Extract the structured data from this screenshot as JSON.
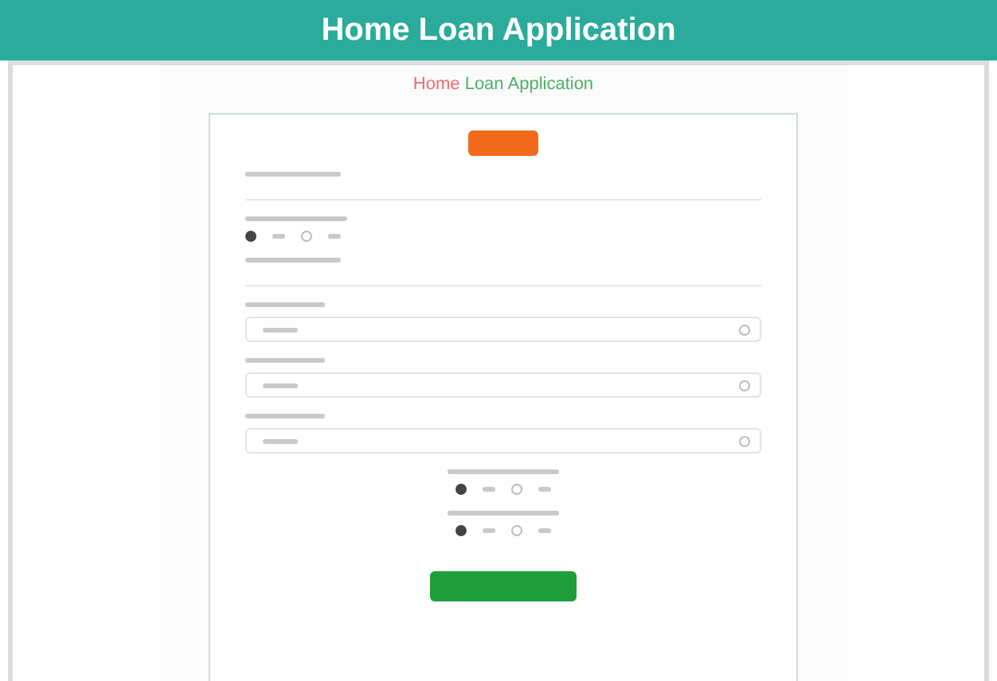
{
  "header": {
    "title": "Home Loan Application"
  },
  "form_heading": [
    {
      "text": "Home",
      "color": "#f06a6a"
    },
    {
      "text": "Loan Application",
      "color": "#4caf68"
    }
  ],
  "form": {
    "rows": [
      {
        "kind": "input"
      },
      {
        "kind": "radio-group",
        "options": [
          {
            "selected": true
          },
          {
            "selected": false
          }
        ]
      },
      {
        "kind": "input"
      },
      {
        "kind": "select"
      },
      {
        "kind": "select"
      },
      {
        "kind": "select"
      },
      {
        "kind": "centered-radio-group",
        "options": [
          {
            "selected": true
          },
          {
            "selected": false
          }
        ]
      },
      {
        "kind": "centered-radio-group",
        "options": [
          {
            "selected": true
          },
          {
            "selected": false
          }
        ]
      }
    ]
  }
}
